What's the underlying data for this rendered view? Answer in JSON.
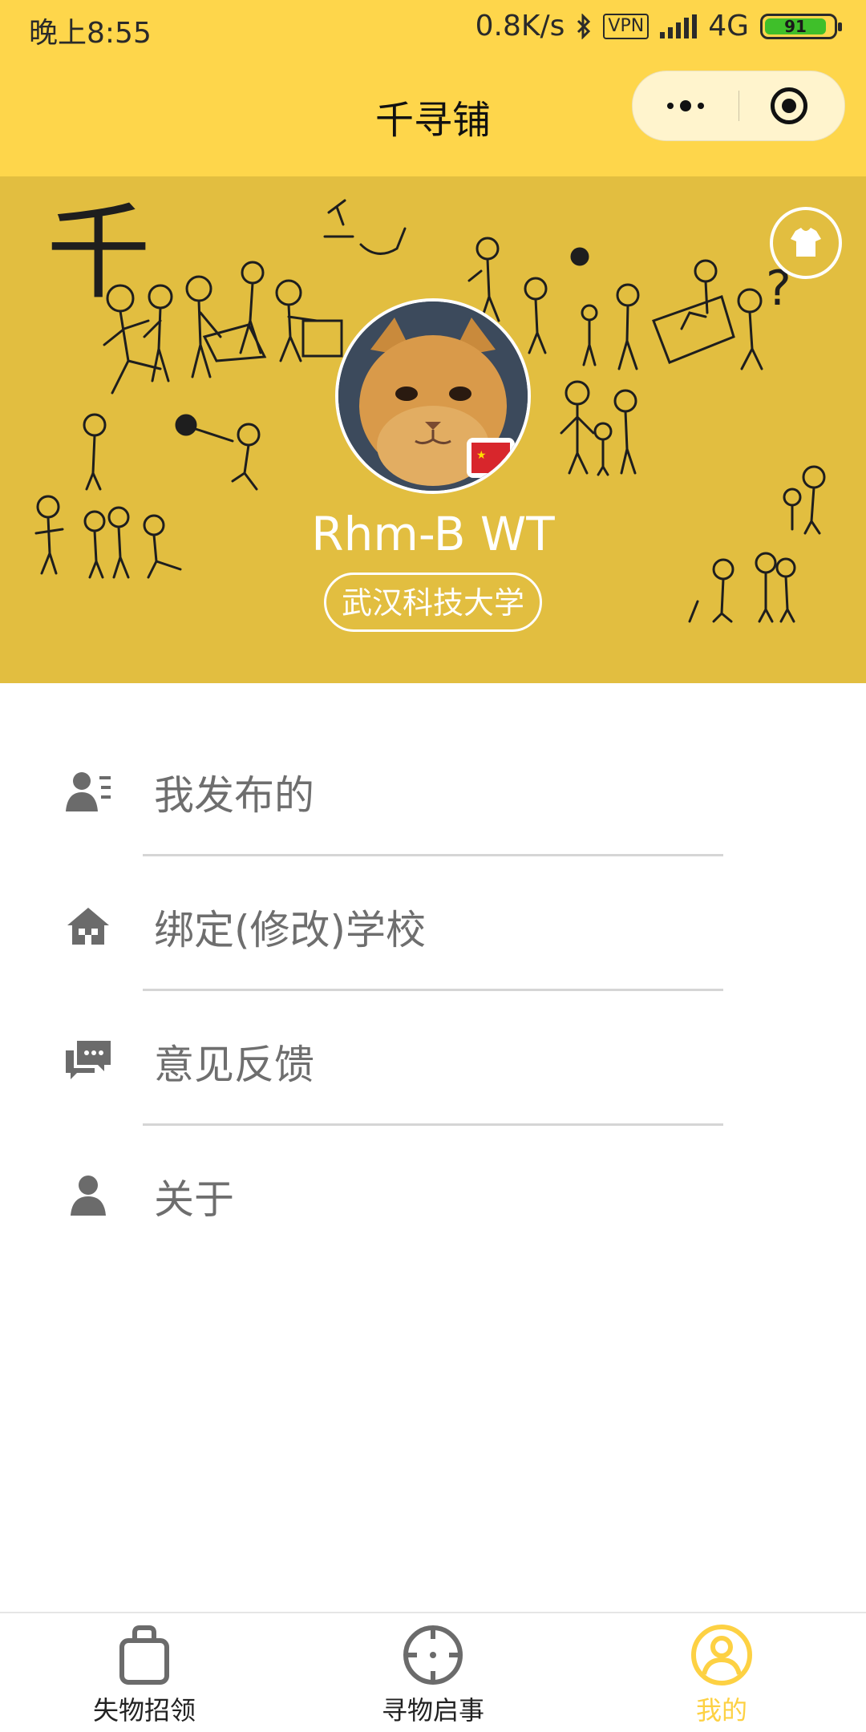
{
  "status_bar": {
    "time": "晚上8:55",
    "network_speed": "0.8K/s",
    "vpn": "VPN",
    "network_type": "4G",
    "battery": "91"
  },
  "nav": {
    "title": "千寻铺"
  },
  "profile": {
    "name": "Rhm-B WT",
    "school": "武汉科技大学",
    "doodle_text": "千"
  },
  "menu": {
    "items": [
      {
        "label": "我发布的",
        "icon": "user-list-icon"
      },
      {
        "label": "绑定(修改)学校",
        "icon": "home-icon"
      },
      {
        "label": "意见反馈",
        "icon": "chat-icon"
      },
      {
        "label": "关于",
        "icon": "user-icon"
      }
    ]
  },
  "tabbar": {
    "tabs": [
      {
        "label": "失物招领",
        "icon": "bag-icon",
        "active": false
      },
      {
        "label": "寻物启事",
        "icon": "crosshair-icon",
        "active": false
      },
      {
        "label": "我的",
        "icon": "profile-icon",
        "active": true
      }
    ],
    "active_color": "#FDD143"
  },
  "colors": {
    "header": "#FED64B",
    "banner": "#E2BE40"
  }
}
